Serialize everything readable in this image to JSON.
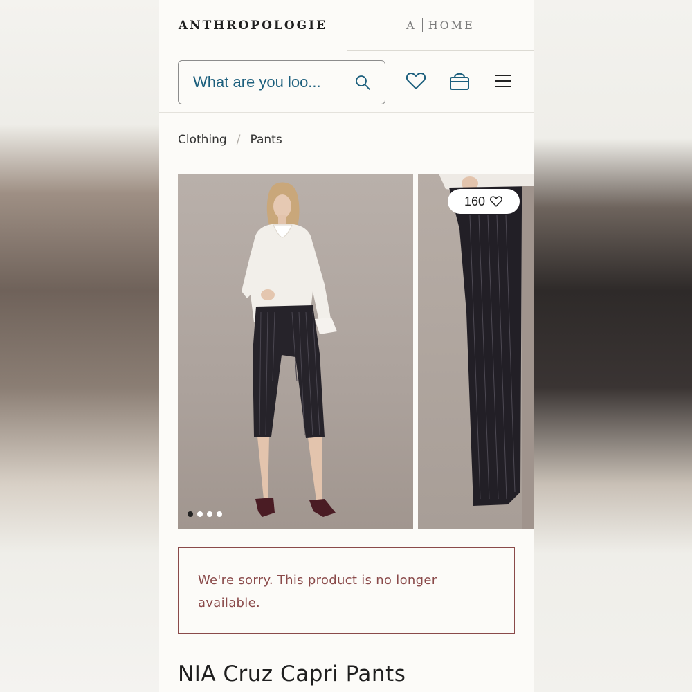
{
  "brand": {
    "logo_text": "ANTHROPOLOGIE",
    "home_prefix": "A",
    "home_text": "HOME"
  },
  "header": {
    "search_placeholder": "What are you loo..."
  },
  "breadcrumb": [
    "Clothing",
    "Pants"
  ],
  "gallery": {
    "image_count": 4,
    "active_index": 0,
    "likes": "160"
  },
  "notice": {
    "text": "We're sorry. This product is no longer available."
  },
  "product": {
    "title": "NIA Cruz Capri Pants"
  },
  "colors": {
    "accent_teal": "#1c5f7d",
    "notice_red": "#8a4a4a"
  }
}
